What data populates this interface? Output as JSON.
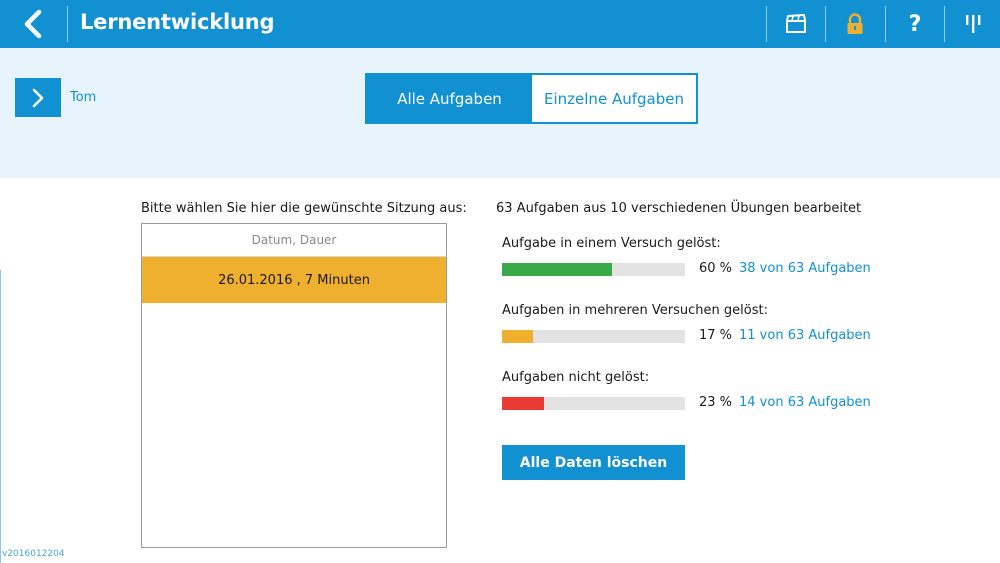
{
  "app": {
    "title": "Lernentwicklung"
  },
  "toolbar": {
    "back_icon": "chevron-left-icon",
    "icons": [
      "clapperboard-icon",
      "lock-icon",
      "help-icon",
      "menu-bars-icon"
    ],
    "help_label": "?",
    "lock_color": "#f0b02f"
  },
  "learner": {
    "name": "Tom"
  },
  "tabs": [
    {
      "label": "Alle Aufgaben",
      "active": true
    },
    {
      "label": "Einzelne Aufgaben",
      "active": false
    }
  ],
  "sessions": {
    "prompt": "Bitte wählen Sie hier die gewünschte Sitzung aus:",
    "column_header": "Datum, Dauer",
    "items": [
      {
        "label": "26.01.2016 , 7 Minuten",
        "selected": true
      }
    ]
  },
  "stats": {
    "summary": "63 Aufgaben aus 10 verschiedenen Übungen bearbeitet",
    "rows": [
      {
        "label": "Aufgabe in einem Versuch gelöst:",
        "percent": 60,
        "percent_text": "60 %",
        "count_text": "38 von 63 Aufgaben",
        "color": "#3aaa48"
      },
      {
        "label": "Aufgaben in mehreren Versuchen gelöst:",
        "percent": 17,
        "percent_text": "17 %",
        "count_text": "11 von 63 Aufgaben",
        "color": "#f0b02f"
      },
      {
        "label": "Aufgaben nicht gelöst:",
        "percent": 23,
        "percent_text": "23 %",
        "count_text": "14 von 63 Aufgaben",
        "color": "#ea3a35"
      }
    ]
  },
  "actions": {
    "delete_label": "Alle Daten löschen"
  },
  "footer": {
    "version": "v2016012204"
  },
  "colors": {
    "primary": "#1191d2",
    "band": "#e8f4fb"
  }
}
